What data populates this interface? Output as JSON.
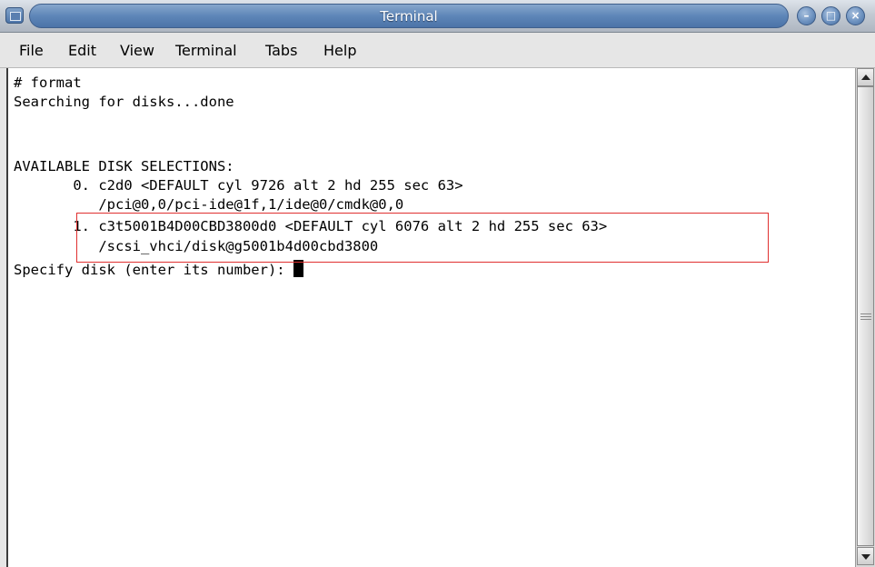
{
  "window": {
    "title": "Terminal",
    "title_color": "#5e86b8",
    "controls": [
      "minimize-icon",
      "maximize-icon",
      "close-icon"
    ]
  },
  "menubar": {
    "items": [
      {
        "label": "File"
      },
      {
        "label": "Edit"
      },
      {
        "label": "View"
      },
      {
        "label": "Terminal"
      },
      {
        "label": "Tabs"
      },
      {
        "label": "Help"
      }
    ]
  },
  "terminal": {
    "lines": [
      "# format",
      "Searching for disks...done",
      "",
      "",
      "AVAILABLE DISK SELECTIONS:",
      "       0. c2d0 <DEFAULT cyl 9726 alt 2 hd 255 sec 63>",
      "          /pci@0,0/pci-ide@1f,1/ide@0/cmdk@0,0",
      "       1. c3t5001B4D00CBD3800d0 <DEFAULT cyl 6076 alt 2 hd 255 sec 63>",
      "          /scsi_vhci/disk@g5001b4d00cbd3800",
      "Specify disk (enter its number): "
    ],
    "highlight_color": "#e0302f"
  }
}
